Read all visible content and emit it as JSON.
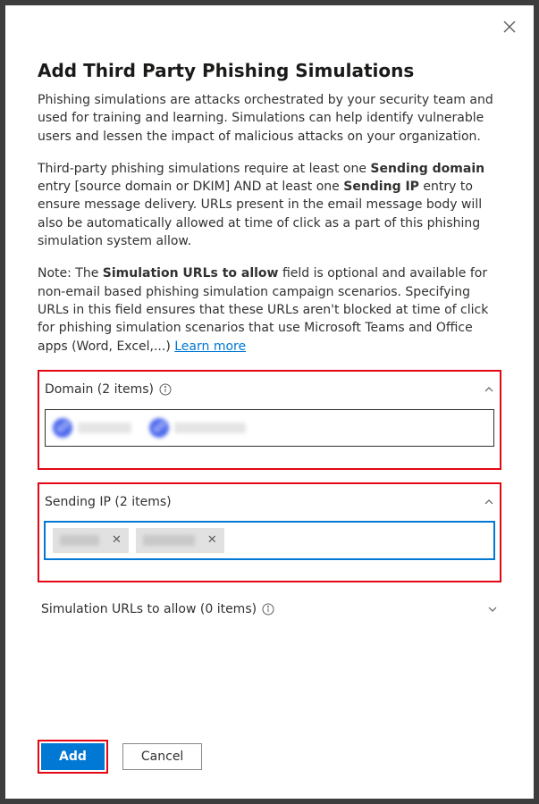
{
  "dialog": {
    "title": "Add Third Party Phishing Simulations",
    "intro": "Phishing simulations are attacks orchestrated by your security team and used for training and learning. Simulations can help identify vulnerable users and lessen the impact of malicious attacks on your organization.",
    "para2_pre": "Third-party phishing simulations require at least one ",
    "para2_b1": "Sending domain",
    "para2_mid": " entry [source domain or DKIM] AND at least one ",
    "para2_b2": "Sending IP",
    "para2_post": " entry to ensure message delivery. URLs present in the email message body will also be automatically allowed at time of click as a part of this phishing simulation system allow.",
    "para3_pre": "Note: The ",
    "para3_b1": "Simulation URLs to allow",
    "para3_post": " field is optional and available for non-email based phishing simulation campaign scenarios. Specifying URLs in this field ensures that these URLs aren't blocked at time of click for phishing simulation scenarios that use Microsoft Teams and Office apps (Word, Excel,...) ",
    "learn_more": "Learn more"
  },
  "sections": {
    "domain": {
      "label": "Domain (2 items)"
    },
    "sending_ip": {
      "label": "Sending IP (2 items)"
    },
    "sim_urls": {
      "label": "Simulation URLs to allow (0 items)"
    }
  },
  "footer": {
    "add": "Add",
    "cancel": "Cancel"
  }
}
